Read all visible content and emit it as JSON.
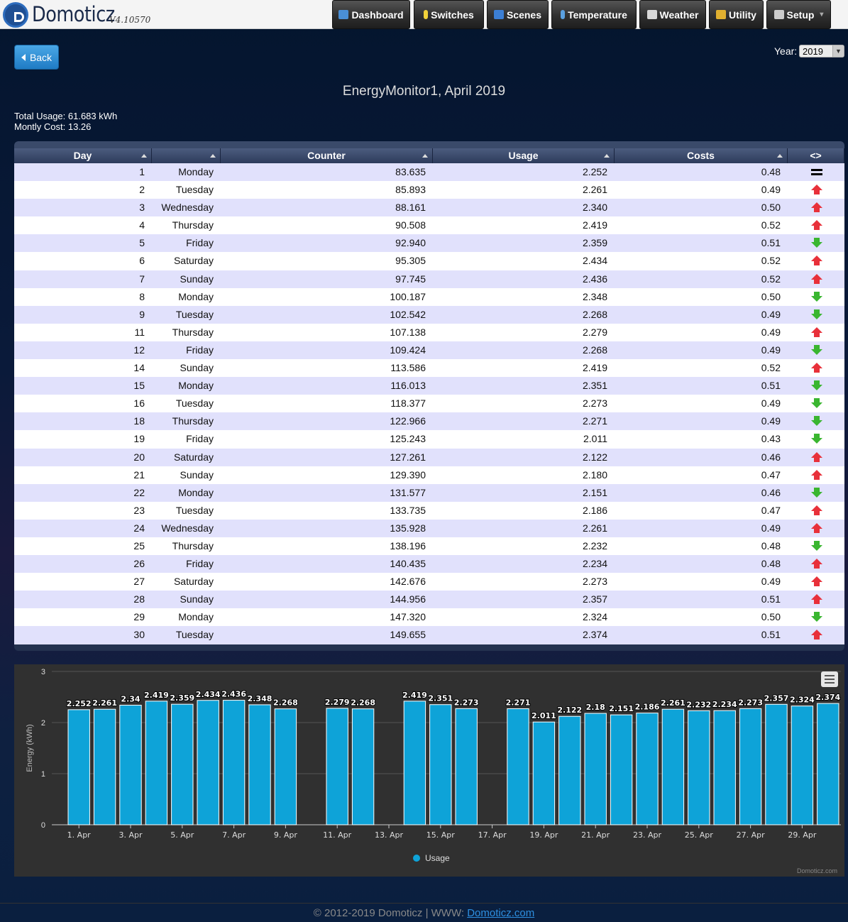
{
  "app": {
    "brand": "Domoticz",
    "version": "V4.10570"
  },
  "nav": [
    {
      "label": "Dashboard",
      "icon": "dashboard-icon",
      "color": "#4a8fd6"
    },
    {
      "label": "Switches",
      "icon": "lightbulb-icon",
      "color": "#f2d23a"
    },
    {
      "label": "Scenes",
      "icon": "scenes-icon",
      "color": "#3c7fd4"
    },
    {
      "label": "Temperature",
      "icon": "thermometer-icon",
      "color": "#5aa0e0"
    },
    {
      "label": "Weather",
      "icon": "weather-icon",
      "color": "#d8d8d8"
    },
    {
      "label": "Utility",
      "icon": "utility-icon",
      "color": "#e0b030"
    },
    {
      "label": "Setup",
      "icon": "tools-icon",
      "color": "#cccccc"
    }
  ],
  "back_label": "Back",
  "year": {
    "label": "Year:",
    "value": "2019"
  },
  "page_title": "EnergyMonitor1, April 2019",
  "summary": {
    "total_usage": "Total Usage: 61.683 kWh",
    "monthly_cost": "Montly Cost: 13.26"
  },
  "table": {
    "headers": [
      "Day",
      "",
      "Counter",
      "Usage",
      "Costs",
      "<>"
    ],
    "rows": [
      {
        "day": "1",
        "weekday": "Monday",
        "counter": "83.635",
        "usage": "2.252",
        "cost": "0.48",
        "trend": "equal"
      },
      {
        "day": "2",
        "weekday": "Tuesday",
        "counter": "85.893",
        "usage": "2.261",
        "cost": "0.49",
        "trend": "up"
      },
      {
        "day": "3",
        "weekday": "Wednesday",
        "counter": "88.161",
        "usage": "2.340",
        "cost": "0.50",
        "trend": "up"
      },
      {
        "day": "4",
        "weekday": "Thursday",
        "counter": "90.508",
        "usage": "2.419",
        "cost": "0.52",
        "trend": "up"
      },
      {
        "day": "5",
        "weekday": "Friday",
        "counter": "92.940",
        "usage": "2.359",
        "cost": "0.51",
        "trend": "down"
      },
      {
        "day": "6",
        "weekday": "Saturday",
        "counter": "95.305",
        "usage": "2.434",
        "cost": "0.52",
        "trend": "up"
      },
      {
        "day": "7",
        "weekday": "Sunday",
        "counter": "97.745",
        "usage": "2.436",
        "cost": "0.52",
        "trend": "up"
      },
      {
        "day": "8",
        "weekday": "Monday",
        "counter": "100.187",
        "usage": "2.348",
        "cost": "0.50",
        "trend": "down"
      },
      {
        "day": "9",
        "weekday": "Tuesday",
        "counter": "102.542",
        "usage": "2.268",
        "cost": "0.49",
        "trend": "down"
      },
      {
        "day": "11",
        "weekday": "Thursday",
        "counter": "107.138",
        "usage": "2.279",
        "cost": "0.49",
        "trend": "up"
      },
      {
        "day": "12",
        "weekday": "Friday",
        "counter": "109.424",
        "usage": "2.268",
        "cost": "0.49",
        "trend": "down"
      },
      {
        "day": "14",
        "weekday": "Sunday",
        "counter": "113.586",
        "usage": "2.419",
        "cost": "0.52",
        "trend": "up"
      },
      {
        "day": "15",
        "weekday": "Monday",
        "counter": "116.013",
        "usage": "2.351",
        "cost": "0.51",
        "trend": "down"
      },
      {
        "day": "16",
        "weekday": "Tuesday",
        "counter": "118.377",
        "usage": "2.273",
        "cost": "0.49",
        "trend": "down"
      },
      {
        "day": "18",
        "weekday": "Thursday",
        "counter": "122.966",
        "usage": "2.271",
        "cost": "0.49",
        "trend": "down"
      },
      {
        "day": "19",
        "weekday": "Friday",
        "counter": "125.243",
        "usage": "2.011",
        "cost": "0.43",
        "trend": "down"
      },
      {
        "day": "20",
        "weekday": "Saturday",
        "counter": "127.261",
        "usage": "2.122",
        "cost": "0.46",
        "trend": "up"
      },
      {
        "day": "21",
        "weekday": "Sunday",
        "counter": "129.390",
        "usage": "2.180",
        "cost": "0.47",
        "trend": "up"
      },
      {
        "day": "22",
        "weekday": "Monday",
        "counter": "131.577",
        "usage": "2.151",
        "cost": "0.46",
        "trend": "down"
      },
      {
        "day": "23",
        "weekday": "Tuesday",
        "counter": "133.735",
        "usage": "2.186",
        "cost": "0.47",
        "trend": "up"
      },
      {
        "day": "24",
        "weekday": "Wednesday",
        "counter": "135.928",
        "usage": "2.261",
        "cost": "0.49",
        "trend": "up"
      },
      {
        "day": "25",
        "weekday": "Thursday",
        "counter": "138.196",
        "usage": "2.232",
        "cost": "0.48",
        "trend": "down"
      },
      {
        "day": "26",
        "weekday": "Friday",
        "counter": "140.435",
        "usage": "2.234",
        "cost": "0.48",
        "trend": "up"
      },
      {
        "day": "27",
        "weekday": "Saturday",
        "counter": "142.676",
        "usage": "2.273",
        "cost": "0.49",
        "trend": "up"
      },
      {
        "day": "28",
        "weekday": "Sunday",
        "counter": "144.956",
        "usage": "2.357",
        "cost": "0.51",
        "trend": "up"
      },
      {
        "day": "29",
        "weekday": "Monday",
        "counter": "147.320",
        "usage": "2.324",
        "cost": "0.50",
        "trend": "down"
      },
      {
        "day": "30",
        "weekday": "Tuesday",
        "counter": "149.655",
        "usage": "2.374",
        "cost": "0.51",
        "trend": "up"
      }
    ]
  },
  "chart_data": {
    "type": "bar",
    "ylabel": "Energy (kWh)",
    "ylim": [
      0,
      3
    ],
    "yticks": [
      0,
      1,
      2,
      3
    ],
    "xticks": [
      "1. Apr",
      "3. Apr",
      "5. Apr",
      "7. Apr",
      "9. Apr",
      "11. Apr",
      "13. Apr",
      "15. Apr",
      "17. Apr",
      "19. Apr",
      "21. Apr",
      "23. Apr",
      "25. Apr",
      "27. Apr",
      "29. Apr"
    ],
    "legend": {
      "position": "bottom-center"
    },
    "grid": true,
    "color": "#0ea3d8",
    "series": [
      {
        "name": "Usage",
        "points": [
          {
            "day": 1,
            "value": 2.252,
            "label": "2.252"
          },
          {
            "day": 2,
            "value": 2.261,
            "label": "2.261"
          },
          {
            "day": 3,
            "value": 2.34,
            "label": "2.34"
          },
          {
            "day": 4,
            "value": 2.419,
            "label": "2.419"
          },
          {
            "day": 5,
            "value": 2.359,
            "label": "2.359"
          },
          {
            "day": 6,
            "value": 2.434,
            "label": "2.434"
          },
          {
            "day": 7,
            "value": 2.436,
            "label": "2.436"
          },
          {
            "day": 8,
            "value": 2.348,
            "label": "2.348"
          },
          {
            "day": 9,
            "value": 2.268,
            "label": "2.268"
          },
          {
            "day": 11,
            "value": 2.279,
            "label": "2.279"
          },
          {
            "day": 12,
            "value": 2.268,
            "label": "2.268"
          },
          {
            "day": 14,
            "value": 2.419,
            "label": "2.419"
          },
          {
            "day": 15,
            "value": 2.351,
            "label": "2.351"
          },
          {
            "day": 16,
            "value": 2.273,
            "label": "2.273"
          },
          {
            "day": 18,
            "value": 2.271,
            "label": "2.271"
          },
          {
            "day": 19,
            "value": 2.011,
            "label": "2.011"
          },
          {
            "day": 20,
            "value": 2.122,
            "label": "2.122"
          },
          {
            "day": 21,
            "value": 2.18,
            "label": "2.18"
          },
          {
            "day": 22,
            "value": 2.151,
            "label": "2.151"
          },
          {
            "day": 23,
            "value": 2.186,
            "label": "2.186"
          },
          {
            "day": 24,
            "value": 2.261,
            "label": "2.261"
          },
          {
            "day": 25,
            "value": 2.232,
            "label": "2.232"
          },
          {
            "day": 26,
            "value": 2.234,
            "label": "2.234"
          },
          {
            "day": 27,
            "value": 2.273,
            "label": "2.273"
          },
          {
            "day": 28,
            "value": 2.357,
            "label": "2.357"
          },
          {
            "day": 29,
            "value": 2.324,
            "label": "2.324"
          },
          {
            "day": 30,
            "value": 2.374,
            "label": "2.374"
          }
        ]
      }
    ],
    "credit": "Domoticz.com"
  },
  "footer": {
    "text": "© 2012-2019 Domoticz | WWW: ",
    "link": "Domoticz.com"
  }
}
